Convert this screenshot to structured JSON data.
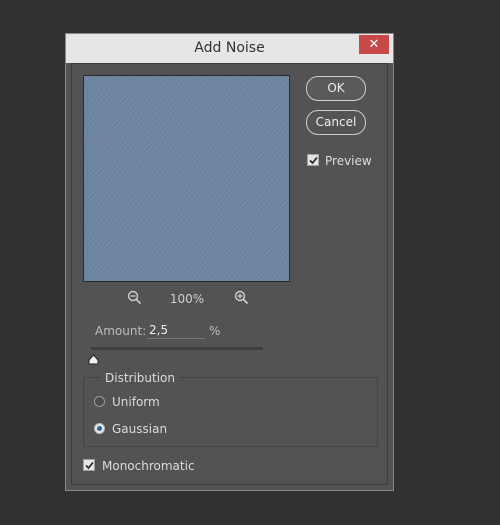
{
  "dialog": {
    "title": "Add Noise",
    "close_symbol": "✕"
  },
  "buttons": {
    "ok_label": "OK",
    "cancel_label": "Cancel"
  },
  "preview": {
    "label": "Preview",
    "checked": true,
    "zoom_level": "100%",
    "zoom_out_icon": "zoom-out-icon",
    "zoom_in_icon": "zoom-in-icon",
    "noise_base_color": "#6b83a1"
  },
  "amount": {
    "label": "Amount:",
    "value": "2,5",
    "unit": "%"
  },
  "distribution": {
    "legend": "Distribution",
    "options": [
      {
        "label": "Uniform",
        "selected": false
      },
      {
        "label": "Gaussian",
        "selected": true
      }
    ]
  },
  "monochromatic": {
    "label": "Monochromatic",
    "checked": true
  },
  "colors": {
    "background": "#323232",
    "dialog_body": "#535353",
    "titlebar": "#e6e6e6",
    "close_button": "#c84848",
    "radio_dot": "#2f5f9f"
  }
}
